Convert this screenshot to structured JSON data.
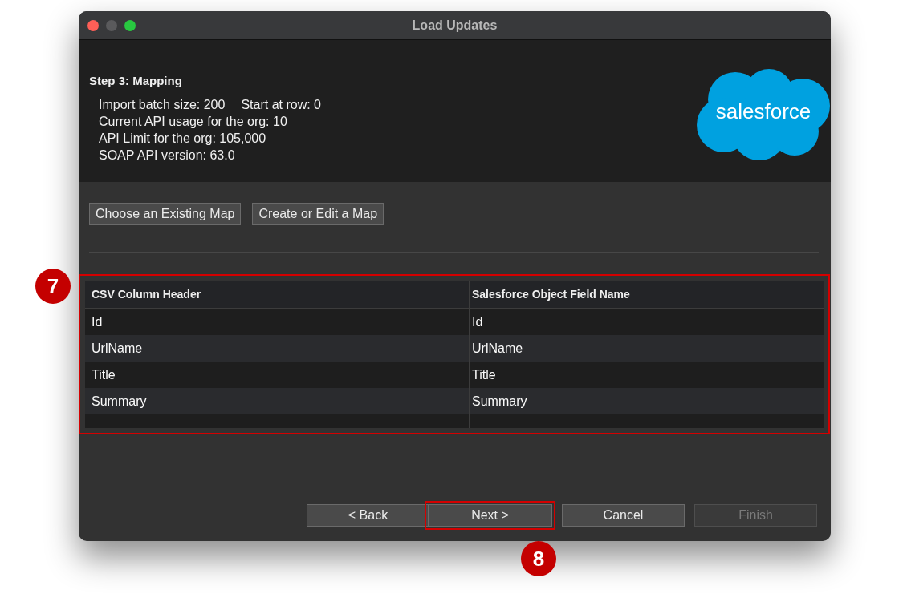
{
  "window": {
    "title": "Load Updates"
  },
  "header": {
    "step": "Step 3: Mapping",
    "info": [
      [
        "Import batch size: 200",
        "Start at row: 0"
      ],
      [
        "Current API usage for the org: 10"
      ],
      [
        "API Limit for the org: 105,000"
      ],
      [
        "SOAP API version: 63.0"
      ]
    ],
    "logo": {
      "text": "salesforce"
    }
  },
  "map_buttons": [
    {
      "label": "Choose an Existing Map"
    },
    {
      "label": "Create or Edit a Map"
    }
  ],
  "table": {
    "highlighted": true,
    "columns": [
      "CSV Column Header",
      "Salesforce Object Field Name"
    ],
    "rows": [
      [
        "Id",
        "Id"
      ],
      [
        "UrlName",
        "UrlName"
      ],
      [
        "Title",
        "Title"
      ],
      [
        "Summary",
        "Summary"
      ]
    ]
  },
  "buttons": [
    {
      "label": "< Back",
      "disabled": false,
      "highlighted": false
    },
    {
      "label": "Next >",
      "disabled": false,
      "highlighted": true
    },
    {
      "label": "Cancel",
      "disabled": false,
      "highlighted": false
    },
    {
      "label": "Finish",
      "disabled": true,
      "highlighted": false
    }
  ],
  "callouts": [
    {
      "label": "7"
    },
    {
      "label": "8"
    }
  ]
}
